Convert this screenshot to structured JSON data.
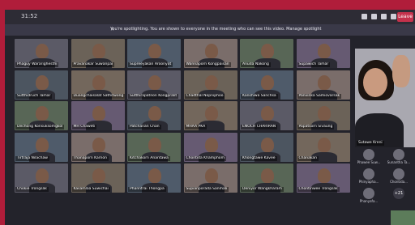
{
  "toolbar": {
    "time": "31:52",
    "leave_label": "Leave"
  },
  "banner": {
    "text": "You're spotlighting. You are shown to everyone in the meeting who can see this video. Manage spotlight"
  },
  "participants": [
    {
      "name": "Phaguy Wararighesthi"
    },
    {
      "name": "Pravanakar Suwanpai"
    },
    {
      "name": "Supreeyakan Aroonyot"
    },
    {
      "name": "Wannaporn Kongpaisan"
    },
    {
      "name": "Anuda Nakong"
    },
    {
      "name": "Supawich Tamar"
    },
    {
      "name": "Sutthidruch Tamar"
    },
    {
      "name": "Duangchaisalat Sathitwong"
    },
    {
      "name": "Sutthirapatnon Kongpralit"
    },
    {
      "name": "Chadthal Nopniphoo"
    },
    {
      "name": "Kanshiwa Sanchsa"
    },
    {
      "name": "Panvinka Samiovarsak"
    },
    {
      "name": "Dechong Konsuksomgkol"
    },
    {
      "name": "MH Chaweti"
    },
    {
      "name": "Patchanan Chan"
    },
    {
      "name": "MHAA PKA"
    },
    {
      "name": "ENOCH CHARIRAN"
    },
    {
      "name": "Papatsorn Sivaung"
    },
    {
      "name": "Tirtraja Nilachaw"
    },
    {
      "name": "Thanaporn Karnon"
    },
    {
      "name": "Kitchakorn Anantawa"
    },
    {
      "name": "Chontida Khamphom"
    },
    {
      "name": "Khongtawe Kavee"
    },
    {
      "name": "Chanakan"
    },
    {
      "name": "Chokie Trongsak"
    },
    {
      "name": "Kasamlaa Suwichai"
    },
    {
      "name": "Phanntrai Thongpa"
    },
    {
      "name": "Supianporada Sanmali"
    },
    {
      "name": "Deniyor Wangkharam"
    },
    {
      "name": "Chontinwee Trongsak"
    }
  ],
  "spotlight": {
    "name": "Sutawe Kreni"
  },
  "side_participants": [
    {
      "name": "Phawee Suw..."
    },
    {
      "name": "Sunantha Ta..."
    },
    {
      "name": "Phinyapha..."
    },
    {
      "name": "Chontida..."
    },
    {
      "name": "Phanyafa..."
    },
    {
      "name": "+21"
    }
  ],
  "colors": {
    "accent": "#c4314b",
    "frame": "#b01d3a",
    "background": "#23232b"
  }
}
